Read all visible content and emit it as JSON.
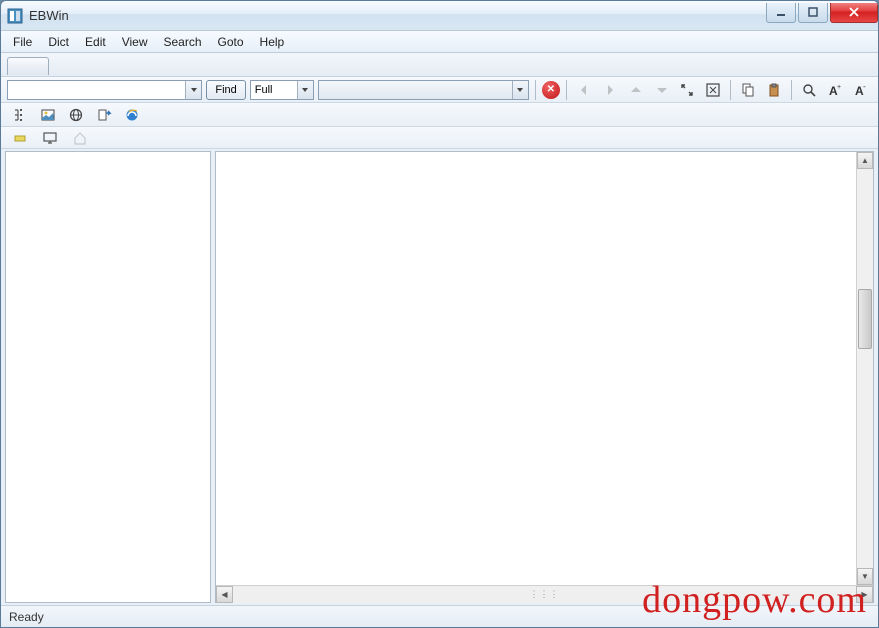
{
  "window": {
    "title": "EBWin"
  },
  "menu": {
    "file": "File",
    "dict": "Dict",
    "edit": "Edit",
    "view": "View",
    "search": "Search",
    "goto": "Goto",
    "help": "Help"
  },
  "toolbar": {
    "search_value": "",
    "find_label": "Find",
    "mode_value": "Full",
    "dict_value": ""
  },
  "status": {
    "text": "Ready"
  },
  "watermark": "dongpow.com"
}
